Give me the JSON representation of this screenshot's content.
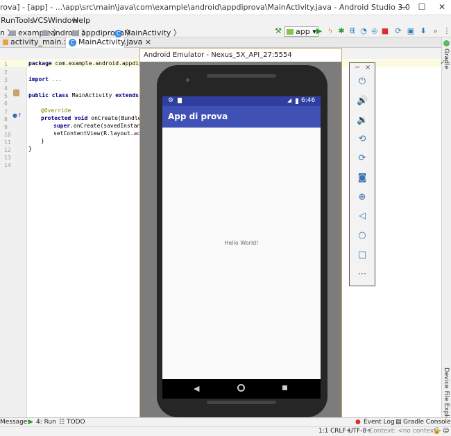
{
  "window": {
    "title": "rova] - [app] - ...\\app\\src\\main\\java\\com\\example\\android\\appdiprova\\MainActivity.java - Android Studio 3.0"
  },
  "menu": [
    "Run",
    "Tools",
    "VCS",
    "Window",
    "Help"
  ],
  "breadcrumb": {
    "items": [
      "n",
      "example",
      "android",
      "appdiprova",
      "MainActivity"
    ]
  },
  "toolbar": {
    "run_config": "app"
  },
  "tabs": [
    {
      "label": "activity_main.xml"
    },
    {
      "label": "MainActivity.java"
    }
  ],
  "editor": {
    "line_numbers": [
      "1",
      "2",
      "3",
      "4",
      "5",
      "6",
      "7",
      "8",
      "9",
      "10",
      "11",
      "12",
      "13",
      "14"
    ],
    "lines": {
      "l1_kw": "package",
      "l1_rest": " com.example.android.appdipro",
      "l3_kw": "import",
      "l3_rest": " ...",
      "l5_kw1": "public class",
      "l5_mid": " MainActivity ",
      "l5_kw2": "extends",
      "l5_rest": " Ap",
      "l7": "@Override",
      "l8_kw": "protected void",
      "l8_rest": " onCreate(Bundle s",
      "l9_kw": "super",
      "l9_rest": ".onCreate(savedInstance",
      "l10_a": "setContentView(R.layout.",
      "l10_b": "acti",
      "l11": "}",
      "l12": "}"
    }
  },
  "right_strip": {
    "gradle": "Gradle",
    "device_explorer": "Device File Explorer"
  },
  "emulator": {
    "title": "Android Emulator - Nexus_5X_API_27:5554",
    "time": "6:46",
    "app_title": "App di prova",
    "hello": "Hello World!",
    "panel_min": "−",
    "panel_close": "×"
  },
  "bottom_tools": {
    "messages": "Messages",
    "run": "4: Run",
    "todo": "TODO",
    "event_log": "Event Log",
    "gradle_console": "Gradle Console"
  },
  "status": {
    "position": "1:1",
    "line_sep": "CRLF÷",
    "encoding": "UTF-8÷",
    "context": "Context: <no context>"
  },
  "colors": {
    "app_bar": "#3f51b5",
    "status_bar": "#303f9f"
  }
}
